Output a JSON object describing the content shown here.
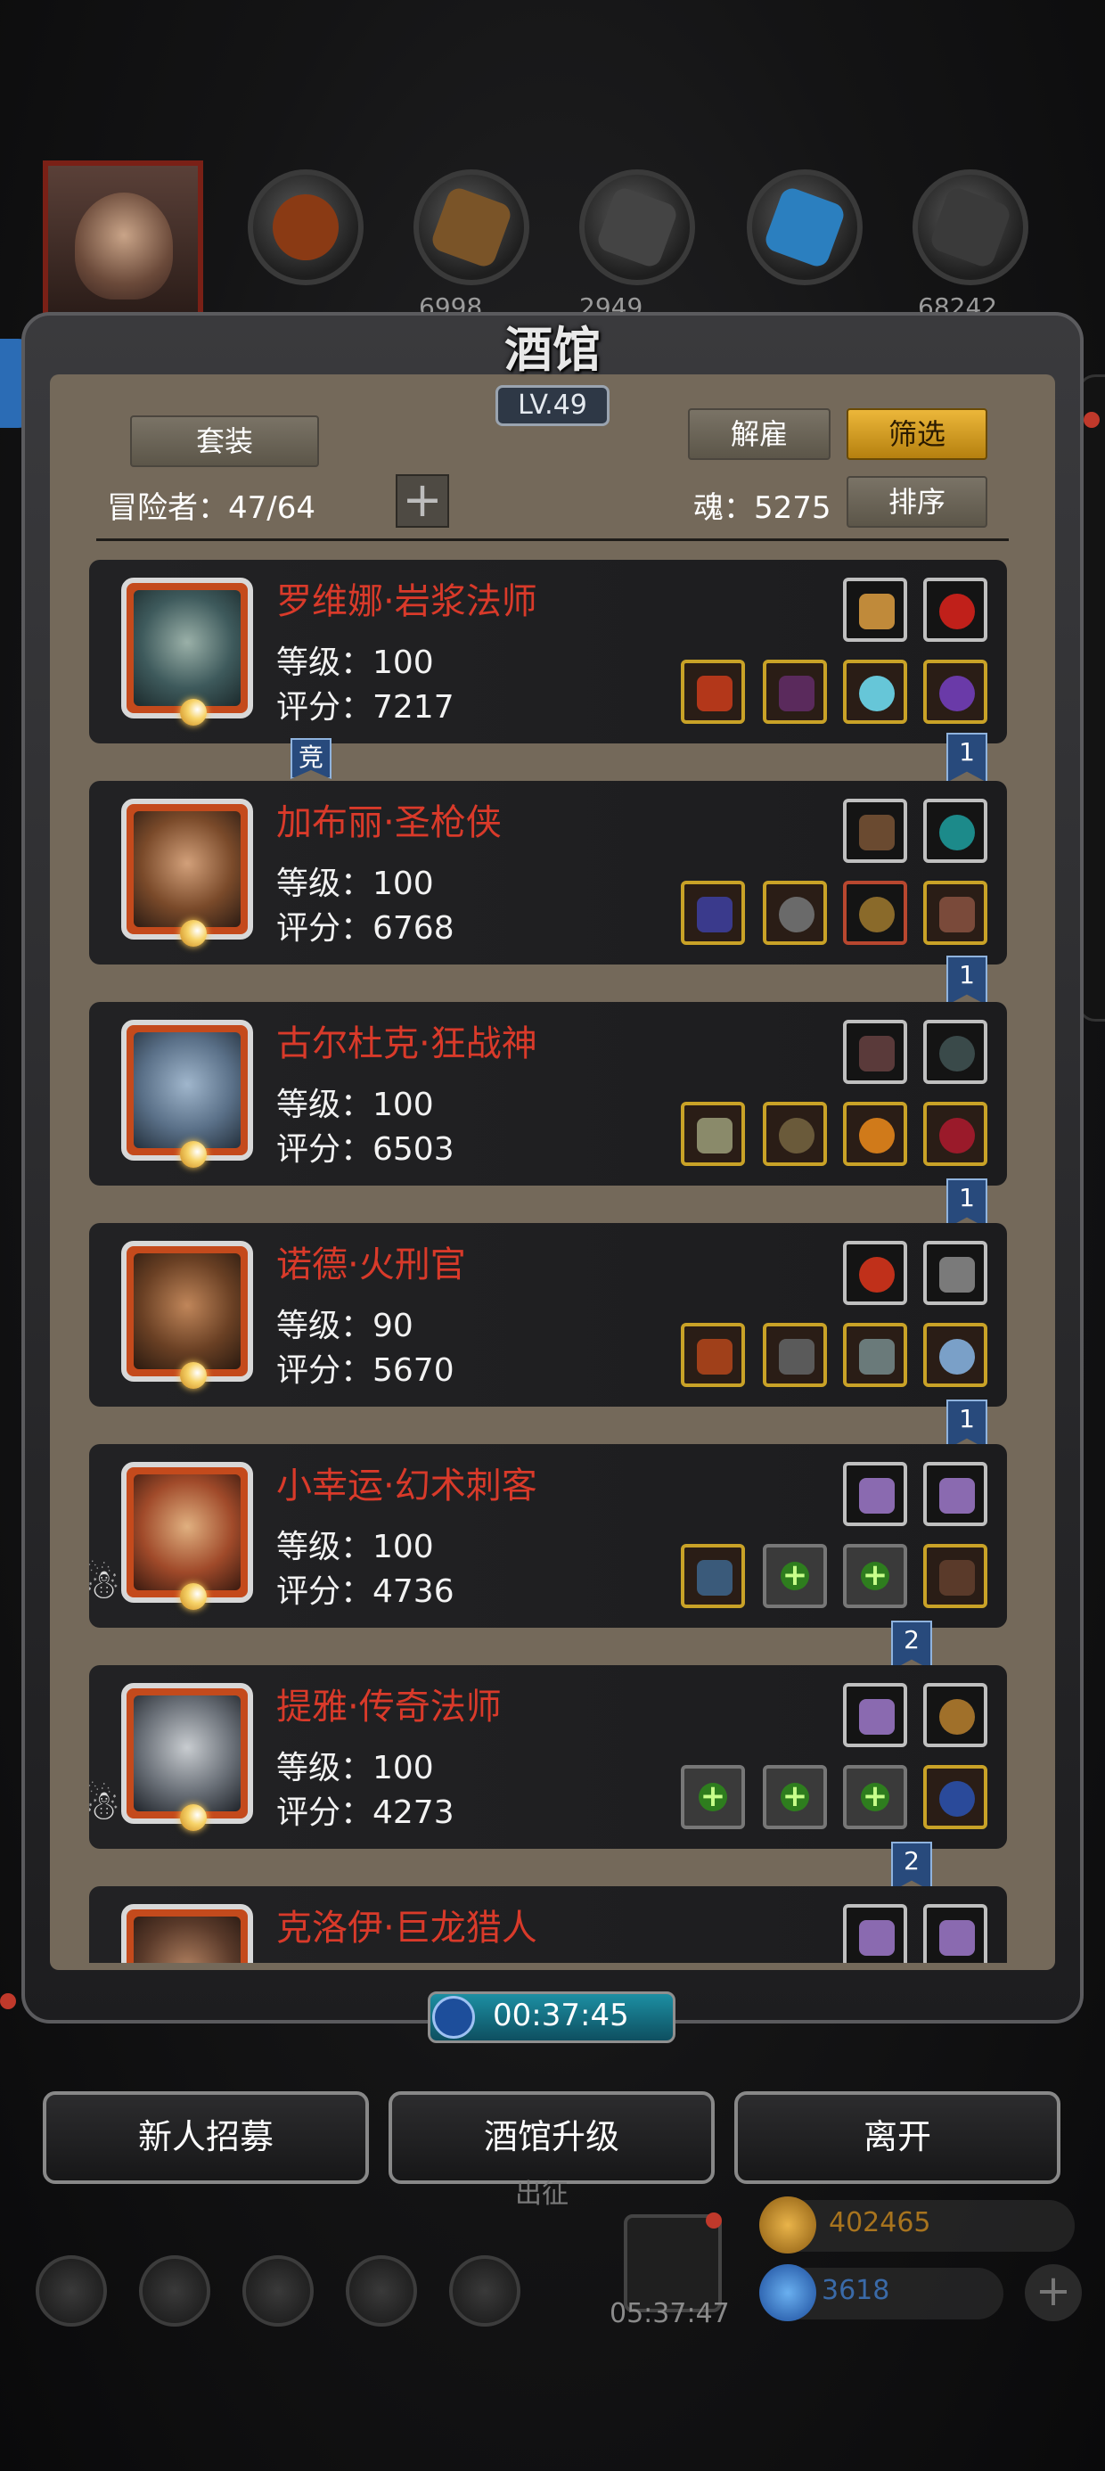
{
  "colors": {
    "panel_bg": "#74695a",
    "card_bg": "#1f1f21",
    "name_red": "#d93a2a",
    "gold_button": "#d9a22a",
    "timer_teal": "#1c8fa3"
  },
  "topbar": {
    "resources": [
      {
        "icon": "meat-icon",
        "value": ""
      },
      {
        "icon": "wood-icon",
        "value": "6998"
      },
      {
        "icon": "iron-icon",
        "value": "2949"
      },
      {
        "icon": "crystal-icon",
        "value": ""
      },
      {
        "icon": "stone-icon",
        "value": "68242"
      }
    ]
  },
  "tavern": {
    "title": "酒馆",
    "level": "LV.49",
    "btn_suits": "套装",
    "btn_dismiss": "解雇",
    "btn_filter": "筛选",
    "btn_sort": "排序",
    "adventurers_label": "冒险者：47/64",
    "souls_label": "魂：5275"
  },
  "heroes": [
    {
      "name": "罗维娜·岩浆法师",
      "level": "等级：100",
      "score": "评分：7217",
      "top_items": [
        "horned-helm-icon",
        "red-gem-icon"
      ],
      "bottom_items": [
        "fire-staff-icon",
        "purple-robe-icon",
        "frost-rune-icon",
        "purple-ring-icon"
      ],
      "ribbon": "1",
      "left_badge": "竞"
    },
    {
      "name": "加布丽·圣枪侠",
      "level": "等级：100",
      "score": "评分：6768",
      "top_items": [
        "crossbow-icon",
        "teal-gem-icon"
      ],
      "bottom_items": [
        "blue-spear-icon",
        "iron-helm-icon",
        "amulet-icon",
        "leather-boots-icon"
      ],
      "ribbon": "1"
    },
    {
      "name": "古尔杜克·狂战神",
      "level": "等级：100",
      "score": "评分：6503",
      "top_items": [
        "feather-icon",
        "slate-gem-icon"
      ],
      "bottom_items": [
        "battle-axe-icon",
        "skull-helm-icon",
        "gold-ring-icon",
        "red-orb-icon"
      ],
      "ribbon": "1"
    },
    {
      "name": "诺德·火刑官",
      "level": "等级：90",
      "score": "评分：5670",
      "top_items": [
        "fire-gem-icon",
        "spiked-crest-icon"
      ],
      "bottom_items": [
        "flame-axe-icon",
        "chest-armor-icon",
        "gauntlet-icon",
        "silver-ring-icon"
      ],
      "ribbon": "1"
    },
    {
      "name": "小幸运·幻术刺客",
      "level": "等级：100",
      "score": "评分：4736",
      "top_items": [
        "amethyst-icon",
        "amethyst-icon"
      ],
      "bottom_items": [
        "dagger-icon",
        "empty-slot-icon",
        "empty-slot-icon",
        "cloak-icon"
      ],
      "ribbon": "2",
      "ghost": true
    },
    {
      "name": "提雅·传奇法师",
      "level": "等级：100",
      "score": "评分：4273",
      "top_items": [
        "amethyst-icon",
        "bronze-rings-icon"
      ],
      "bottom_items": [
        "empty-slot-icon",
        "empty-slot-icon",
        "empty-slot-icon",
        "potion-icon"
      ],
      "ribbon": "2",
      "ghost": true
    },
    {
      "name": "克洛伊·巨龙猎人",
      "level": "",
      "score": "",
      "top_items": [
        "amethyst-icon",
        "amethyst-icon"
      ],
      "bottom_items": []
    }
  ],
  "footer": {
    "timer": "00:37:45",
    "btn_recruit": "新人招募",
    "btn_upgrade": "酒馆升级",
    "btn_leave": "离开",
    "behind_label": "出征",
    "gift_timer": "05:37:47",
    "gold": "402465",
    "gems": "3618"
  }
}
